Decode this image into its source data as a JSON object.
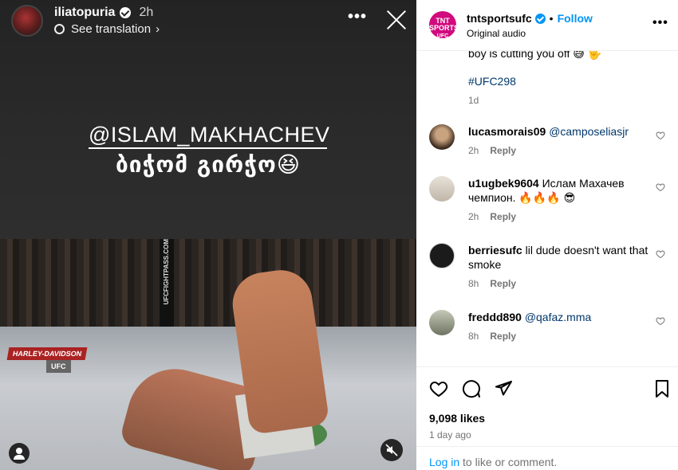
{
  "story": {
    "username": "iliatopuria",
    "time": "2h",
    "see_translation": "See translation",
    "more_icon": "more-horizontal-icon",
    "close_icon": "close-icon",
    "mention": "@ISLAM_MAKHACHEV",
    "caption": "ბიჭომ გირჭო😆",
    "cage_text": "UFCFIGHTPASS.COM",
    "sponsor_left": "HARLEY-DAVIDSON",
    "sponsor_left2": "UFC"
  },
  "post": {
    "username": "tntsportsufc",
    "brand_logo_text": "TNT SPORTS UFC",
    "dot": "•",
    "follow_label": "Follow",
    "audio": "Original audio",
    "caption_tail": "boy is cutting you off 😅 🤟",
    "hashtag": "#UFC298",
    "caption_age": "1d",
    "comments": [
      {
        "user": "lucasmorais09",
        "mention": "@camposeliasjr",
        "text": "",
        "time": "2h",
        "reply": "Reply"
      },
      {
        "user": "u1ugbek9604",
        "mention": "",
        "text": "Ислам Махачев чемпион. 🔥🔥🔥 😎",
        "time": "2h",
        "reply": "Reply"
      },
      {
        "user": "berriesufc",
        "mention": "",
        "text": "lil dude doesn't want that smoke",
        "time": "8h",
        "reply": "Reply"
      },
      {
        "user": "freddd890",
        "mention": "@qafaz.mma",
        "text": "",
        "time": "8h",
        "reply": "Reply"
      }
    ],
    "likes": "9,098 likes",
    "age": "1 day ago",
    "login_link": "Log in",
    "login_rest": " to like or comment."
  }
}
